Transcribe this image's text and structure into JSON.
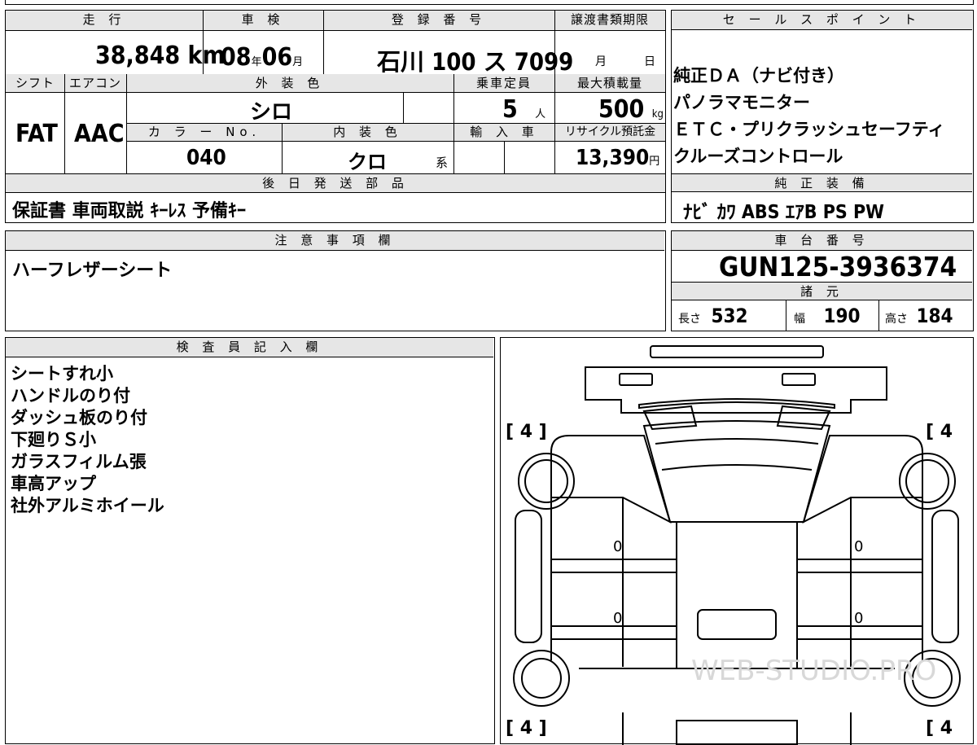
{
  "top": {
    "mileage_label": "走 行",
    "mileage_value": "38,848",
    "mileage_unit": "km",
    "inspection_label": "車 検",
    "inspection_year": "08",
    "year_unit": "年",
    "inspection_month": "06",
    "month_unit": "月",
    "registration_label": "登 録 番 号",
    "registration_value": "石川 100 ス 7099",
    "transfer_label": "譲渡書類期限",
    "transfer_month": "月",
    "transfer_day": "日",
    "shift_label": "シフト",
    "aircon_label": "エアコン",
    "exterior_label": "外 装 色",
    "capacity_label": "乗車定員",
    "load_label": "最大積載量",
    "shift_value": "FAT",
    "aircon_value": "AAC",
    "exterior_value": "シロ",
    "capacity_value": "5",
    "capacity_unit": "人",
    "load_value": "500",
    "load_unit": "kg",
    "color_no_label": "カ ラ ー No.",
    "interior_label": "内 装 色",
    "import_label": "輸 入 車",
    "recycle_label": "リサイクル預託金",
    "color_no_value": "040",
    "interior_value": "クロ",
    "interior_suffix": "系",
    "recycle_value": "13,390",
    "recycle_unit": "円",
    "later_label": "後 日 発 送 部 品",
    "later_value": "保証書 車両取説 ｷｰﾚｽ 予備ｷｰ"
  },
  "sales": {
    "label": "セ ー ル ス ポ イ ン ト",
    "lines": [
      "純正ＤＡ（ナビ付き）",
      "パノラマモニター",
      "ＥＴＣ・プリクラッシュセーフティ",
      "クルーズコントロール"
    ],
    "equip_label": "純 正 装 備",
    "equip_value": "ﾅﾋﾞ ｶﾜ ABS ｴｱB PS PW"
  },
  "notes": {
    "label": "注 意 事 項 欄",
    "value": "ハーフレザーシート"
  },
  "chassis": {
    "label": "車 台 番 号",
    "value": "GUN125-3936374",
    "spec_label": "諸 元",
    "length_label": "長さ",
    "length_value": "532",
    "width_label": "幅",
    "width_value": "190",
    "height_label": "高さ",
    "height_value": "184"
  },
  "inspector": {
    "label": "検 査 員 記 入 欄",
    "lines": [
      "シートすれ小",
      "ハンドルのり付",
      "ダッシュ板のり付",
      "下廻りＳ小",
      "ガラスフィルム張",
      "車高アップ",
      "社外アルミホイール"
    ]
  },
  "diagram": {
    "tire_tl": "[ 4 ]",
    "tire_tr": "[ 4",
    "tire_bl": "[ 4 ]",
    "tire_br": "[ 4",
    "mark_0": "0",
    "watermark": "WEB-STUDIO.PRO"
  }
}
